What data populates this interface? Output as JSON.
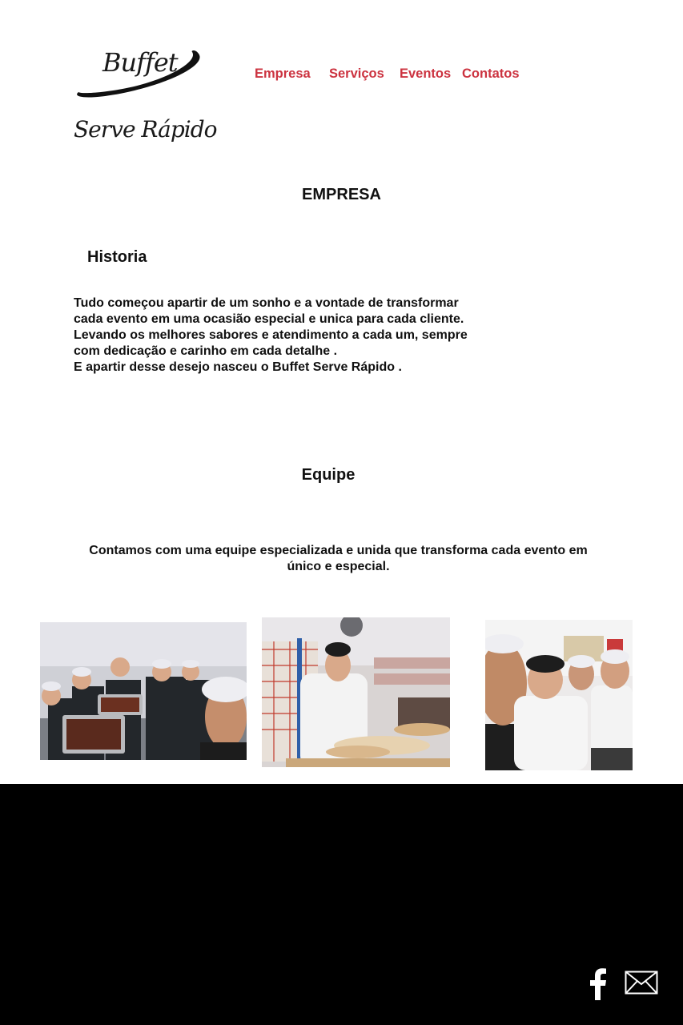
{
  "brand": {
    "line1": "Buffet",
    "line2": "Serve Rápido"
  },
  "nav": {
    "items": [
      "Empresa",
      "Serviços",
      "Eventos",
      "Contatos"
    ],
    "color": "#cc3340"
  },
  "empresa": {
    "title": "EMPRESA",
    "historia_title": "Historia",
    "historia_lines": [
      "Tudo começou apartir de um sonho e a vontade de transformar",
      "cada evento em uma ocasião especial e unica para cada cliente.",
      "Levando os melhores sabores e atendimento a cada um, sempre",
      "com dedicação e carinho em cada detalhe .",
      "E apartir desse desejo nasceu o Buffet Serve Rápido ."
    ]
  },
  "equipe": {
    "title": "Equipe",
    "text": "Contamos com uma equipe especializada e unida que transforma cada evento em único e especial."
  },
  "footer": {
    "background": "#000000",
    "icons": [
      "facebook-icon",
      "mail-icon"
    ]
  }
}
